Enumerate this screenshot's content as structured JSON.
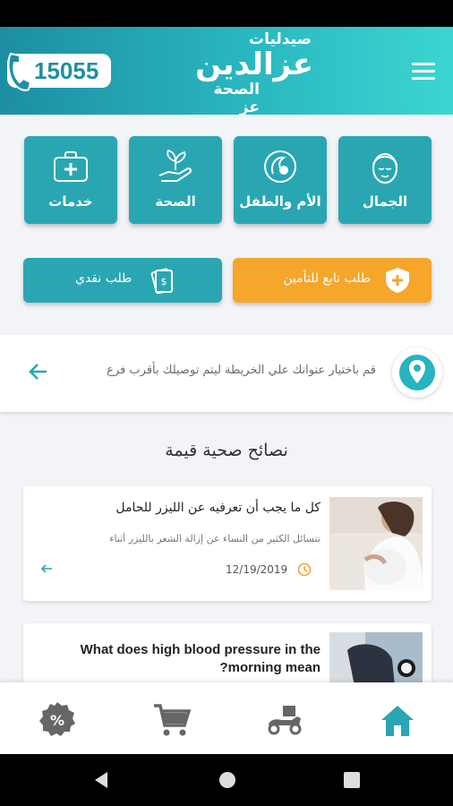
{
  "header": {
    "phone_number": "15055",
    "logo_top": "صيدليات",
    "logo_main": "عزالدين",
    "logo_sub": "الصحة عز"
  },
  "categories": [
    {
      "label": "الجمال",
      "icon": "face-icon"
    },
    {
      "label": "الأم والطفل",
      "icon": "mother-baby-icon"
    },
    {
      "label": "الصحة",
      "icon": "plant-hand-icon"
    },
    {
      "label": "خدمات",
      "icon": "medkit-icon"
    }
  ],
  "orders": {
    "insurance_label": "طلب تابع للتأمين",
    "cash_label": "طلب نقدي"
  },
  "location": {
    "text": "قم باختيار عنوانك علي الخريطة ليتم توصيلك بأقرب فرع"
  },
  "tips": {
    "title": "نصائح صحية قيمة",
    "articles": [
      {
        "title": "كل ما يجب أن تعرفيه عن الليزر للحامل",
        "excerpt": "تتسائل الكثير من النساء عن إزالة الشعر بالليزر أثناء",
        "date": "12/19/2019"
      },
      {
        "title": "What does high blood pressure in the morning mean?"
      }
    ]
  },
  "bottom_nav": [
    "home-icon",
    "delivery-icon",
    "cart-icon",
    "discount-icon"
  ],
  "colors": {
    "primary": "#2aa6b3",
    "accent": "#f6a62a",
    "header_start": "#1d8ea3",
    "header_end": "#3bd6d1"
  }
}
